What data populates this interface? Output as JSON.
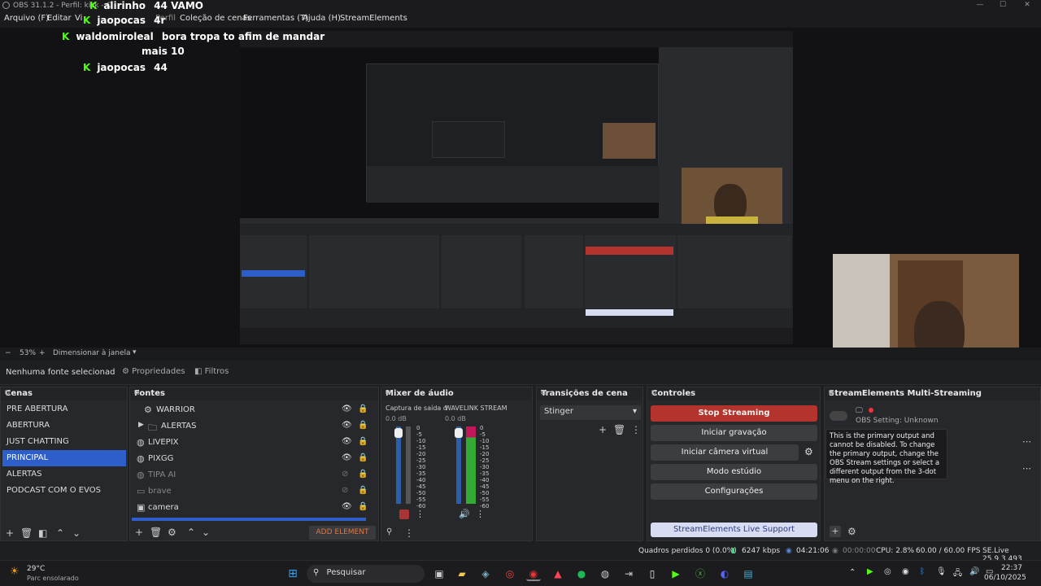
{
  "window": {
    "title": "OBS 31.1.2 - Perfil: kick - C"
  },
  "menu": [
    "Arquivo (F)",
    "Editar",
    "Vi",
    "Perfil",
    "Coleção de cenas",
    "Ferramentas (T)",
    "Ajuda (H)",
    "StreamElements"
  ],
  "chat": [
    {
      "user": "alirinho",
      "msg": "44 VAMO"
    },
    {
      "user": "jaopocas",
      "msg": "4r"
    },
    {
      "user": "waldomiroleal",
      "msg": "bora tropa to afim de mandar",
      "msg2": "mais 10"
    },
    {
      "user": "jaopocas",
      "msg": "44"
    }
  ],
  "zoom": {
    "minus": "−",
    "value": "53%",
    "plus": "+",
    "fit": "Dimensionar à janela"
  },
  "source_bar": {
    "none": "Nenhuma fonte selecionad",
    "props": "Propriedades",
    "filters": "Filtros"
  },
  "scenes": {
    "title": "Cenas",
    "items": [
      "PRE ABERTURA",
      "ABERTURA",
      "JUST CHATTING",
      "PRINCIPAL",
      "ALERTAS",
      "PODCAST COM O EVOS"
    ],
    "selected": 3
  },
  "sources": {
    "title": "Fontes",
    "items": [
      {
        "name": "WARRIOR",
        "icon": "group-icon",
        "dim": false
      },
      {
        "name": "ALERTAS",
        "icon": "folder-icon",
        "dim": false
      },
      {
        "name": "LIVEPIX",
        "icon": "browser-icon",
        "dim": false
      },
      {
        "name": "PIXGG",
        "icon": "browser-icon",
        "dim": false
      },
      {
        "name": "TIPA AI",
        "icon": "browser-icon",
        "dim": true
      },
      {
        "name": "brave",
        "icon": "window-icon",
        "dim": true
      },
      {
        "name": "camera",
        "icon": "camera-icon",
        "dim": false
      }
    ],
    "add_element": "ADD ELEMENT"
  },
  "mixer": {
    "title": "Mixer de áudio",
    "channels": [
      {
        "name": "Captura de saída d",
        "db": "0.0 dB"
      },
      {
        "name": "WAVELINK STREAM",
        "db": "0.0 dB"
      }
    ],
    "ticks": [
      "0",
      "-5",
      "-10",
      "-15",
      "-20",
      "-25",
      "-30",
      "-35",
      "-40",
      "-45",
      "-50",
      "-55",
      "-60"
    ]
  },
  "transitions": {
    "title": "Transições de cena",
    "selected": "Stinger"
  },
  "controls": {
    "title": "Controles",
    "stop_streaming": "Stop Streaming",
    "start_recording": "Iniciar gravação",
    "virtual_camera": "Iniciar câmera virtual",
    "studio_mode": "Modo estúdio",
    "settings": "Configurações",
    "live_support": "StreamElements Live Support"
  },
  "se_multistream": {
    "title": "StreamElements Multi-Streaming",
    "setting": "OBS Setting: Unknown",
    "tooltip": "This is the primary output and cannot be disabled. To change the primary output, change the OBS Stream settings or select a different output from the 3-dot menu on the right."
  },
  "status": {
    "dropped": "Quadros perdidos 0 (0.0%)",
    "kbps": "6247 kbps",
    "live_time": "04:21:06",
    "rec_time": "00:00:00",
    "cpu": "CPU: 2.8%",
    "fps": "60.00 / 60.00 FPS",
    "se_version": "SE.Live 25.9.3.493"
  },
  "taskbar": {
    "temp": "29°C",
    "weather": "Parc ensolarado",
    "search": "Pesquisar",
    "time": "22:37",
    "date": "06/10/2025"
  }
}
